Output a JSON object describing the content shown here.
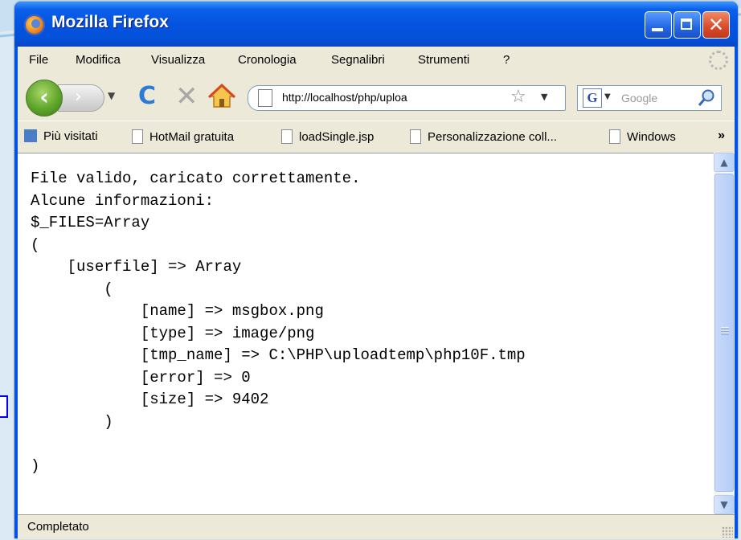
{
  "window": {
    "title": "Mozilla Firefox"
  },
  "menu": [
    {
      "label": "File"
    },
    {
      "label": "Modifica"
    },
    {
      "label": "Visualizza"
    },
    {
      "label": "Cronologia"
    },
    {
      "label": "Segnalibri"
    },
    {
      "label": "Strumenti"
    },
    {
      "label": "?"
    }
  ],
  "nav": {
    "url": "http://localhost/php/uploa",
    "search_placeholder": "Google",
    "search_engine_letter": "G"
  },
  "bookmarks": [
    {
      "label": "Più visitati"
    },
    {
      "label": "HotMail gratuita"
    },
    {
      "label": "loadSingle.jsp"
    },
    {
      "label": "Personalizzazione coll..."
    },
    {
      "label": "Windows"
    }
  ],
  "bookmarks_more": "»",
  "content": {
    "lines": [
      "File valido, caricato correttamente.",
      "Alcune informazioni:",
      "$_FILES=Array",
      "(",
      "    [userfile] => Array",
      "        (",
      "            [name] => msgbox.png",
      "            [type] => image/png",
      "            [tmp_name] => C:\\PHP\\uploadtemp\\php10F.tmp",
      "            [error] => 0",
      "            [size] => 9402",
      "        )",
      "",
      ")"
    ]
  },
  "status": {
    "text": "Completato"
  },
  "colors": {
    "titlebar": "#0554e0",
    "chrome": "#ece9d8",
    "close": "#d9492a"
  }
}
